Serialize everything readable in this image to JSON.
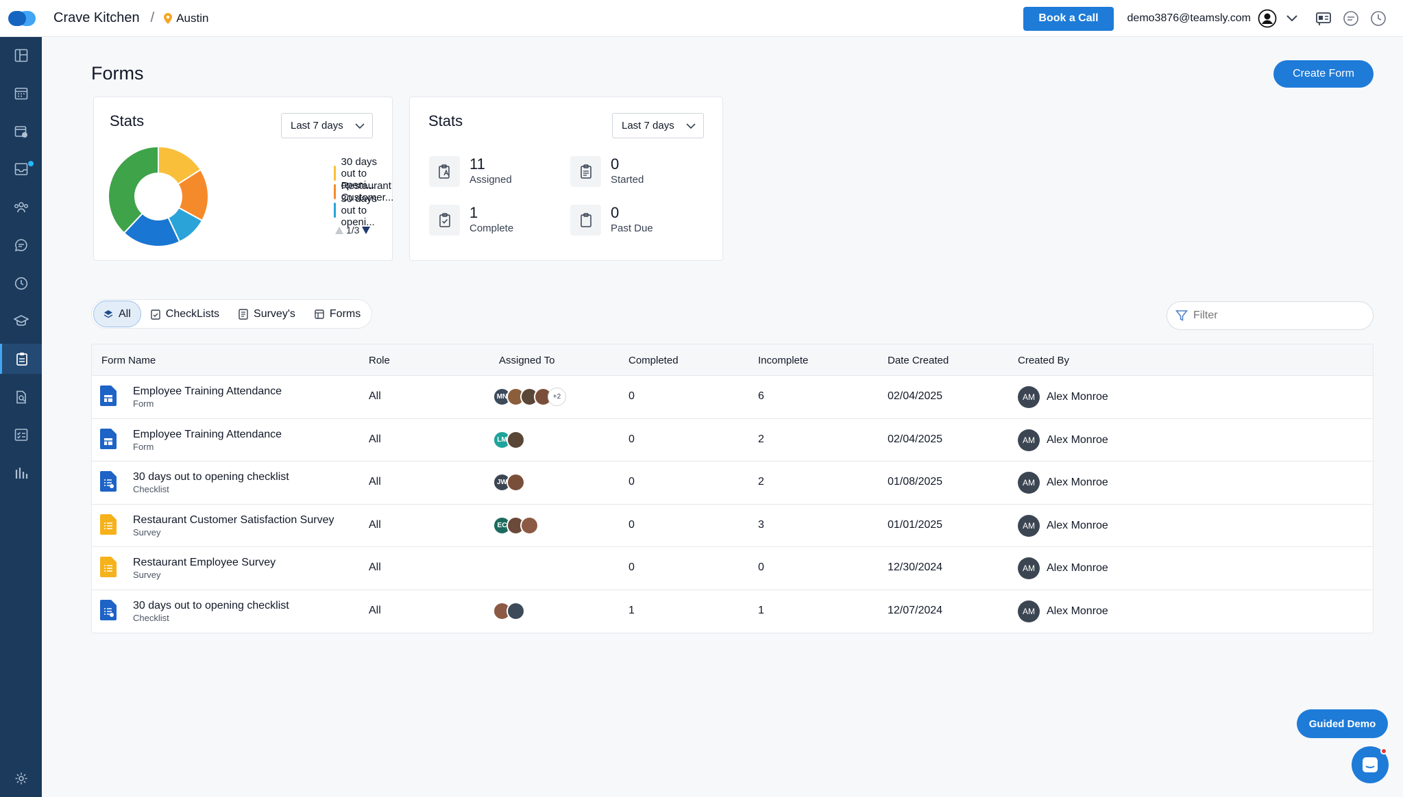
{
  "header": {
    "brand": "Crave Kitchen",
    "separator": "/",
    "location": "Austin",
    "book_call": "Book a Call",
    "email": "demo3876@teamsly.com"
  },
  "page": {
    "title": "Forms",
    "create_button": "Create Form"
  },
  "stats_chart_card": {
    "title": "Stats",
    "range": "Last 7 days",
    "legend": [
      {
        "label": "30 days out to openi...",
        "color": "#f9bf3b"
      },
      {
        "label": "Restaurant Customer...",
        "color": "#f58a2a"
      },
      {
        "label": "30 days out to openi...",
        "color": "#29a3d8"
      }
    ],
    "pager": "1/3"
  },
  "chart_data": {
    "type": "pie",
    "categories": [
      "Yellow",
      "Orange",
      "Light blue",
      "Blue",
      "Green"
    ],
    "values": [
      16,
      17,
      10,
      19,
      38
    ],
    "colors": [
      "#f9bf3b",
      "#f58a2a",
      "#29a3d8",
      "#1976d2",
      "#3ea349"
    ]
  },
  "stats_numbers_card": {
    "title": "Stats",
    "range": "Last 7 days",
    "items": [
      {
        "value": "11",
        "label": "Assigned"
      },
      {
        "value": "0",
        "label": "Started"
      },
      {
        "value": "1",
        "label": "Complete"
      },
      {
        "value": "0",
        "label": "Past Due"
      }
    ]
  },
  "tabs": [
    "All",
    "CheckLists",
    "Survey's",
    "Forms"
  ],
  "filter": {
    "placeholder": "Filter"
  },
  "table": {
    "headers": [
      "Form Name",
      "Role",
      "Assigned To",
      "Completed",
      "Incomplete",
      "Date Created",
      "Created By"
    ],
    "rows": [
      {
        "name": "Employee Training Attendance",
        "type": "Form",
        "icon": "form-icon",
        "role": "All",
        "avatars": [
          "MN",
          "",
          "",
          ""
        ],
        "more": "+2",
        "completed": "0",
        "incomplete": "6",
        "date": "02/04/2025",
        "creator_initials": "AM",
        "creator": "Alex Monroe"
      },
      {
        "name": "Employee Training Attendance",
        "type": "Form",
        "icon": "form-icon",
        "role": "All",
        "avatars": [
          "LM",
          ""
        ],
        "more": "",
        "completed": "0",
        "incomplete": "2",
        "date": "02/04/2025",
        "creator_initials": "AM",
        "creator": "Alex Monroe"
      },
      {
        "name": "30 days out to opening checklist",
        "type": "Checklist",
        "icon": "checklist-icon",
        "role": "All",
        "avatars": [
          "JW",
          ""
        ],
        "more": "",
        "completed": "0",
        "incomplete": "2",
        "date": "01/08/2025",
        "creator_initials": "AM",
        "creator": "Alex Monroe"
      },
      {
        "name": "Restaurant Customer Satisfaction Survey",
        "type": "Survey",
        "icon": "survey-icon",
        "role": "All",
        "avatars": [
          "EC",
          "",
          ""
        ],
        "more": "",
        "completed": "0",
        "incomplete": "3",
        "date": "01/01/2025",
        "creator_initials": "AM",
        "creator": "Alex Monroe"
      },
      {
        "name": "Restaurant Employee Survey",
        "type": "Survey",
        "icon": "survey-icon",
        "role": "All",
        "avatars": [],
        "more": "",
        "completed": "0",
        "incomplete": "0",
        "date": "12/30/2024",
        "creator_initials": "AM",
        "creator": "Alex Monroe"
      },
      {
        "name": "30 days out to opening checklist",
        "type": "Checklist",
        "icon": "checklist-icon",
        "role": "All",
        "avatars": [
          "",
          ""
        ],
        "more": "",
        "completed": "1",
        "incomplete": "1",
        "date": "12/07/2024",
        "creator_initials": "AM",
        "creator": "Alex Monroe"
      }
    ]
  },
  "guided_demo": "Guided Demo"
}
